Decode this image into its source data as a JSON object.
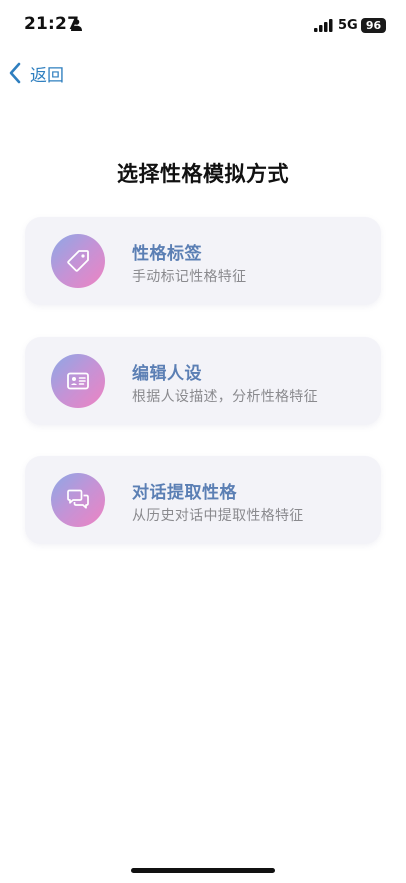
{
  "status_bar": {
    "time": "21:27",
    "network": "5G",
    "battery": "96"
  },
  "nav": {
    "back_label": "返回"
  },
  "page": {
    "title": "选择性格模拟方式"
  },
  "options": [
    {
      "icon": "tag-icon",
      "title": "性格标签",
      "description": "手动标记性格特征"
    },
    {
      "icon": "id-card-icon",
      "title": "编辑人设",
      "description": "根据人设描述，分析性格特征"
    },
    {
      "icon": "chat-bubbles-icon",
      "title": "对话提取性格",
      "description": "从历史对话中提取性格特征"
    }
  ]
}
